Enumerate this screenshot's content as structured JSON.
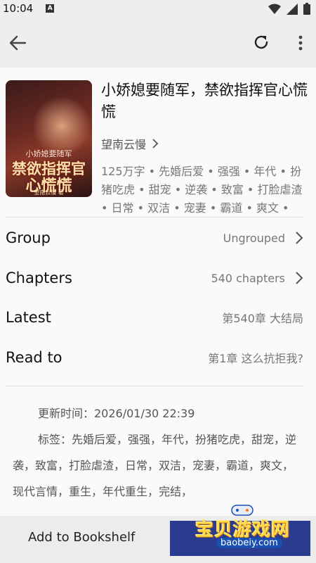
{
  "status": {
    "time": "10:04",
    "notif_letter": "A"
  },
  "book": {
    "title": "小娇媳要随军，禁欲指挥官心慌慌",
    "author": "望南云慢",
    "tags": "125万字 • 先婚后爱 • 强强 • 年代 • 扮猪吃虎 • 甜宠 • 逆袭 • 致富 • 打脸虐渣 • 日常 • 双洁 • 宠妻 • 霸道 • 爽文 • 现…",
    "cover": {
      "small_text": "小娇媳要随军",
      "big_text_1": "禁欲指挥官",
      "big_text_2": "心慌慌",
      "footer": "望南云慢 著"
    }
  },
  "details": {
    "group": {
      "label": "Group",
      "value": "Ungrouped"
    },
    "chapters": {
      "label": "Chapters",
      "value": "540 chapters"
    },
    "latest": {
      "label": "Latest",
      "value": "第540章  大结局"
    },
    "read_to": {
      "label": "Read to",
      "value": "第1章  这么抗拒我?"
    }
  },
  "intro": {
    "updated": "更新时间：2026/01/30 22:39",
    "tags_line": "标签：先婚后爱，强强，年代，扮猪吃虎，甜宠，逆袭，致富，打脸虐渣，日常，双洁，宠妻，霸道，爽文，现代言情，重生，年代重生，完结，"
  },
  "bottom": {
    "add_label": "Add to Bookshelf"
  },
  "watermark": {
    "text": "宝贝游戏网",
    "url": "baobeiy.com"
  },
  "colors": {
    "read_button": "#2b3b8f",
    "bar_bg": "#eeeeee"
  }
}
